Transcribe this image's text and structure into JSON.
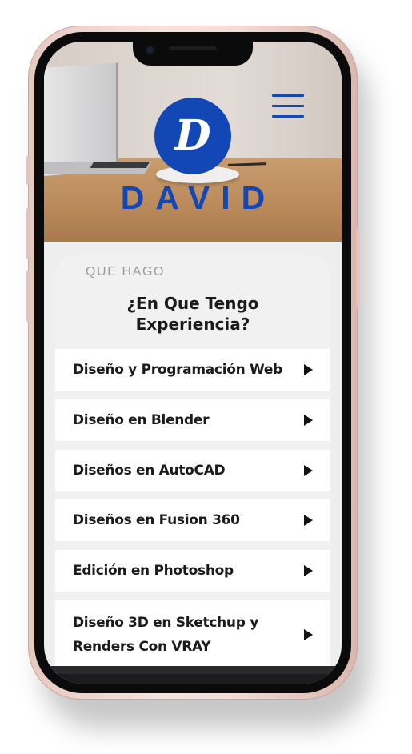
{
  "header": {
    "logo_letter": "D",
    "brand_name": "DAVID"
  },
  "section": {
    "kicker": "QUE HAGO",
    "title": "¿En Que Tengo Experiencia?"
  },
  "services": [
    "Diseño y Programación Web",
    "Diseño en Blender",
    "Diseños en AutoCAD",
    "Diseños en Fusion 360",
    "Edición en Photoshop",
    "Diseño 3D en Sketchup y Renders Con VRAY"
  ],
  "colors": {
    "accent": "#1347b5",
    "card_bg": "#f1f1f1",
    "item_bg": "#ffffff",
    "text": "#1b1b1b"
  }
}
